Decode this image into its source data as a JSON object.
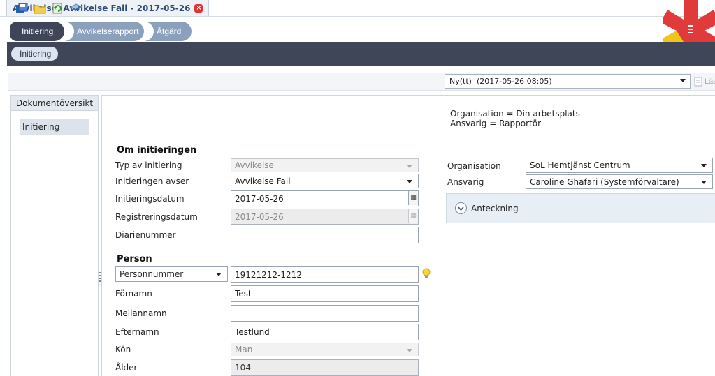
{
  "window": {
    "title": "Avvikelse, Avvikelse Fall - 2017-05-26"
  },
  "steps": [
    {
      "label": "Initiering"
    },
    {
      "label": "Avvikelserapport"
    },
    {
      "label": "Åtgärd"
    }
  ],
  "subtab": {
    "label": "Initiering"
  },
  "toolbar": {
    "icons": [
      "save-icon",
      "open-folder-icon",
      "refresh-icon",
      "check-icon"
    ],
    "version_select": "Ny(tt)  (2017-05-26 08:05)",
    "read_label": "Läs"
  },
  "left_panel": {
    "header": "Dokumentöversikt",
    "items": [
      "Initiering"
    ]
  },
  "info": {
    "line1": "Organisation = Din arbetsplats",
    "line2": "Ansvarig = Rapportör"
  },
  "om_initieringen": {
    "heading": "Om initieringen",
    "typ_label": "Typ av initiering",
    "typ_value": "Avvikelse",
    "avser_label": "Initieringen avser",
    "avser_value": "Avvikelse Fall",
    "datum_label": "Initieringsdatum",
    "datum_value": "2017-05-26",
    "reg_label": "Registreringsdatum",
    "reg_value": "2017-05-26",
    "diarie_label": "Diarienummer",
    "diarie_value": ""
  },
  "person": {
    "heading": "Person",
    "id_type": "Personnummer",
    "id_value": "19121212-1212",
    "fornamn_label": "Förnamn",
    "fornamn_value": "Test",
    "mellannamn_label": "Mellannamn",
    "mellannamn_value": "",
    "efternamn_label": "Efternamn",
    "efternamn_value": "Testlund",
    "kon_label": "Kön",
    "kon_value": "Man",
    "alder_label": "Ålder",
    "alder_value": "104"
  },
  "right_form": {
    "org_label": "Organisation",
    "org_value": "SoL Hemtjänst Centrum",
    "ansvarig_label": "Ansvarig",
    "ansvarig_value": "Caroline Ghafari (Systemförvaltare)",
    "anteckning_label": "Anteckning"
  },
  "colors": {
    "dark_band": "#3e4658",
    "step_inactive": "#8aa0bd",
    "title_text": "#2f4b75"
  }
}
